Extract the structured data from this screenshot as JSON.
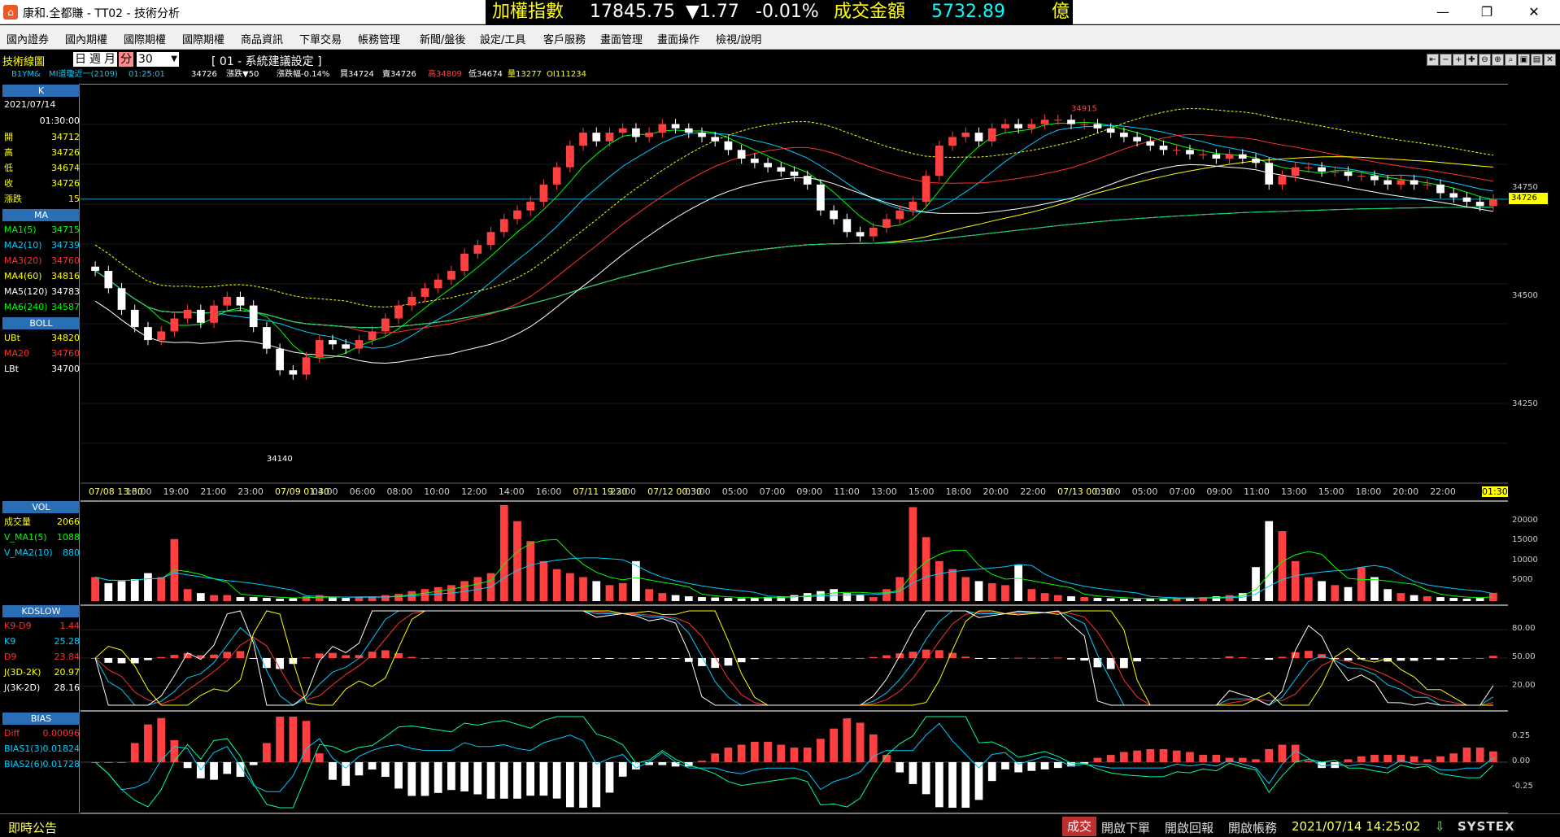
{
  "window": {
    "app_icon": "app-logo-icon",
    "title": "康和.全都賺 - TT02 - 技術分析",
    "minimize": "—",
    "restore": "❐",
    "close": "✕"
  },
  "ticker": {
    "index_label": "加權指數",
    "index_value": "17845.75",
    "change": "▼1.77",
    "change_pct": "-0.01%",
    "turnover_label": "成交金額",
    "turnover_value": "5732.89",
    "turnover_unit": "億",
    "colors": {
      "label": "#ffff00",
      "value": "#ffffff",
      "down": "#00ff00",
      "turnover": "#00ffff"
    }
  },
  "menu": [
    "國內證券",
    "國內期權",
    "國際期權",
    "國際期權",
    "商品資訊",
    "下單交易",
    "帳務管理",
    "新聞/盤後",
    "設定/工具",
    "客戶服務",
    "畫面管理",
    "畫面操作",
    "檢視/說明"
  ],
  "toolbar": {
    "title": "技術線圖",
    "periods": [
      "日",
      "週",
      "月",
      "分"
    ],
    "active_period": "分",
    "interval": "30",
    "preset": "[ 01 - 系統建議設定 ]"
  },
  "infobar": {
    "symbol": "B1YM&",
    "name": "MI道瓊近一(2109)",
    "time": "01:25:01",
    "price": "34726",
    "change": "漲跌▼50",
    "change_pct": "漲跌幅-0.14%",
    "bid": "買34724",
    "ask": "賣34726",
    "high": "高34809",
    "low": "低34674",
    "volume": "量13277",
    "oi": "OI111234"
  },
  "tool_icons": [
    "move-left-icon",
    "minus-icon",
    "plus-icon",
    "add-icon",
    "zoom-out-icon",
    "zoom-in-icon",
    "search-icon",
    "save-icon",
    "print-icon",
    "close-panel-icon"
  ],
  "side": {
    "k_header": "K",
    "date": "2021/07/14",
    "time": "01:30:00",
    "ohlc": [
      {
        "label": "開",
        "value": "34712"
      },
      {
        "label": "高",
        "value": "34726"
      },
      {
        "label": "低",
        "value": "34674"
      },
      {
        "label": "收",
        "value": "34726"
      },
      {
        "label": "漲跌",
        "value": "15"
      }
    ],
    "ma_header": "MA",
    "ma": [
      {
        "label": "MA1(5)",
        "value": "34715",
        "color": "#00ff00"
      },
      {
        "label": "MA2(10)",
        "value": "34739",
        "color": "#00ccff"
      },
      {
        "label": "MA3(20)",
        "value": "34760",
        "color": "#ff3030"
      },
      {
        "label": "MA4(60)",
        "value": "34816",
        "color": "#ffff00"
      },
      {
        "label": "MA5(120)",
        "value": "34783",
        "color": "#ffffff"
      },
      {
        "label": "MA6(240)",
        "value": "34587",
        "color": "#00ff00"
      }
    ],
    "boll_header": "BOLL",
    "boll": [
      {
        "label": "UBt",
        "value": "34820",
        "color": "#ffff00"
      },
      {
        "label": "MA20",
        "value": "34760",
        "color": "#ff3030"
      },
      {
        "label": "LBt",
        "value": "34700",
        "color": "#ffffff"
      }
    ],
    "vol_header": "VOL",
    "vol": [
      {
        "label": "成交量",
        "value": "2066",
        "color": "#ffff00"
      },
      {
        "label": "V_MA1(5)",
        "value": "1088",
        "color": "#00ff00"
      },
      {
        "label": "V_MA2(10)",
        "value": "880",
        "color": "#00ccff"
      }
    ],
    "kd_header": "KDSLOW",
    "kd": [
      {
        "label": "K9-D9",
        "value": "1.44",
        "color": "#ff3030"
      },
      {
        "label": "K9",
        "value": "25.28",
        "color": "#00ccff"
      },
      {
        "label": "D9",
        "value": "23.84",
        "color": "#ff3030"
      },
      {
        "label": "J(3D-2K)",
        "value": "20.97",
        "color": "#ffff00"
      },
      {
        "label": "J(3K-2D)",
        "value": "28.16",
        "color": "#ffffff"
      }
    ],
    "bias_header": "BIAS",
    "bias": [
      {
        "label": "Diff",
        "value": "0.00096",
        "color": "#ff3030"
      },
      {
        "label": "BIAS1(3)",
        "value": "0.01824",
        "color": "#00ccff"
      },
      {
        "label": "BIAS2(6)",
        "value": "0.01728",
        "color": "#00ccff"
      }
    ]
  },
  "chart_data": {
    "type": "candlestick",
    "price_axis": {
      "ticks": [
        "34750",
        "34500",
        "34250"
      ],
      "ylim": [
        34080,
        34980
      ],
      "current": "34726"
    },
    "x_labels": [
      "07/08 13:30",
      "16:00",
      "19:00",
      "21:00",
      "23:00",
      "07/09 01:30",
      "04:00",
      "06:00",
      "08:00",
      "10:00",
      "12:00",
      "14:00",
      "16:00",
      "07/11 19:30",
      "22:00",
      "07/12 00:30",
      "03:00",
      "05:00",
      "07:00",
      "09:00",
      "11:00",
      "13:00",
      "15:00",
      "18:00",
      "20:00",
      "22:00",
      "07/13 00:30",
      "03:00",
      "05:00",
      "07:00",
      "09:00",
      "11:00",
      "13:00",
      "15:00",
      "18:00",
      "20:00",
      "22:00",
      "01:30"
    ],
    "annotations": [
      "34915",
      "34140"
    ],
    "close": [
      34560,
      34520,
      34470,
      34430,
      34400,
      34420,
      34450,
      34470,
      34440,
      34480,
      34500,
      34480,
      34430,
      34380,
      34330,
      34320,
      34360,
      34400,
      34390,
      34380,
      34400,
      34420,
      34450,
      34480,
      34500,
      34520,
      34540,
      34560,
      34600,
      34620,
      34650,
      34680,
      34700,
      34720,
      34760,
      34800,
      34850,
      34880,
      34860,
      34880,
      34890,
      34870,
      34880,
      34900,
      34890,
      34880,
      34870,
      34860,
      34840,
      34820,
      34810,
      34800,
      34790,
      34780,
      34760,
      34700,
      34680,
      34650,
      34640,
      34660,
      34680,
      34700,
      34720,
      34780,
      34850,
      34870,
      34880,
      34860,
      34890,
      34900,
      34890,
      34900,
      34910,
      34910,
      34900,
      34900,
      34890,
      34880,
      34870,
      34860,
      34850,
      34840,
      34840,
      34830,
      34830,
      34820,
      34830,
      34820,
      34810,
      34760,
      34780,
      34800,
      34800,
      34790,
      34790,
      34780,
      34780,
      34770,
      34760,
      34770,
      34760,
      34760,
      34740,
      34730,
      34720,
      34710,
      34726
    ],
    "volume_axis": {
      "ticks": [
        "20000",
        "15000",
        "10000",
        "5000"
      ],
      "ylim": [
        0,
        24000
      ]
    },
    "volume": [
      6000,
      4500,
      5000,
      5500,
      7000,
      6000,
      15500,
      3000,
      2000,
      1500,
      1500,
      1000,
      1000,
      800,
      600,
      700,
      1200,
      1500,
      900,
      800,
      1000,
      1200,
      1500,
      1800,
      2500,
      3000,
      3500,
      4000,
      5000,
      6000,
      7000,
      24000,
      20000,
      15000,
      10000,
      8000,
      7000,
      6000,
      5000,
      4000,
      4500,
      10000,
      3000,
      2000,
      1500,
      1200,
      1000,
      900,
      800,
      700,
      800,
      1000,
      1200,
      1500,
      2000,
      2500,
      3000,
      2000,
      1500,
      1000,
      3000,
      6000,
      23500,
      16000,
      10000,
      8000,
      6000,
      5000,
      4500,
      4000,
      9000,
      3000,
      2000,
      1500,
      1200,
      1000,
      800,
      700,
      600,
      500,
      600,
      700,
      800,
      900,
      1000,
      1200,
      1500,
      2000,
      8500,
      20000,
      17500,
      10000,
      6000,
      5000,
      4000,
      3500,
      8500,
      6000,
      3000,
      2000,
      1500,
      1200,
      1000,
      800,
      600,
      800,
      2066
    ],
    "kd_axis": {
      "ticks": [
        "80.00",
        "50.00",
        "20.00"
      ],
      "ylim": [
        0,
        100
      ]
    },
    "bias_axis": {
      "ticks": [
        "0.25",
        "0.00",
        "-0.25"
      ],
      "ylim": [
        -0.45,
        0.45
      ]
    }
  }
}
